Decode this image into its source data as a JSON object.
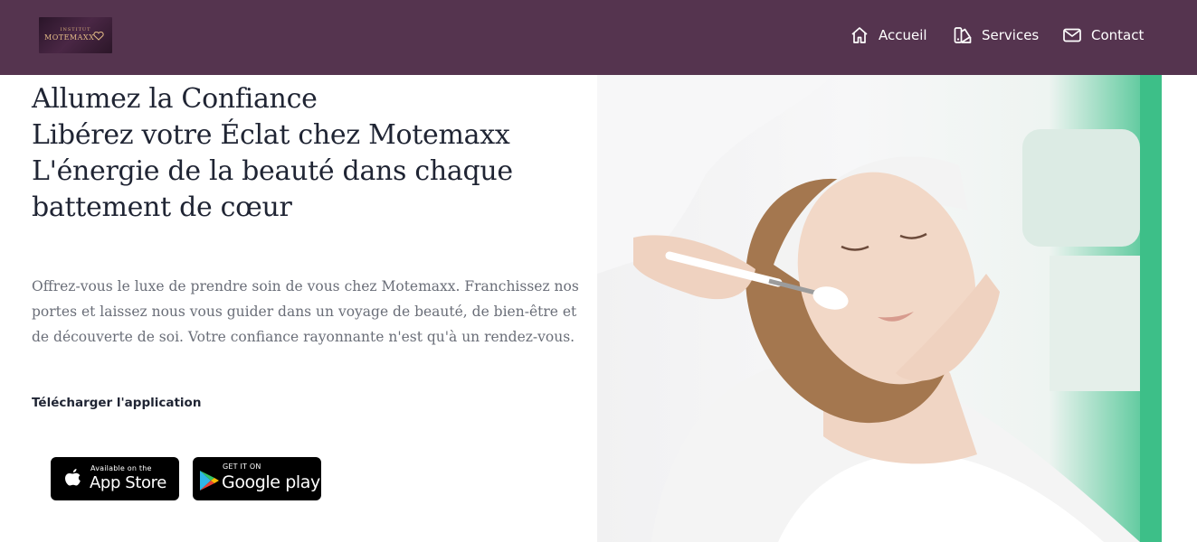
{
  "header": {
    "logo": {
      "line1": "INSTITUT",
      "line2": "MOTEMAXX"
    },
    "nav": [
      {
        "label": "Accueil",
        "icon": "home-icon"
      },
      {
        "label": "Services",
        "icon": "services-icon"
      },
      {
        "label": "Contact",
        "icon": "mail-icon"
      }
    ],
    "colors": {
      "bar": "#55344f",
      "nav_text": "#ffffff"
    }
  },
  "hero": {
    "title_lines": [
      "Allumez la Confiance",
      "Libérez votre Éclat chez Motemaxx",
      "L'énergie de la beauté dans chaque battement de cœur"
    ],
    "paragraph": "Offrez-vous le luxe de prendre soin de vous chez Motemaxx. Franchissez nos portes et laissez nous vous guider dans un voyage de beauté, de bien-être et de découverte de soi. Votre confiance rayonnante n'est qu'à un rendez-vous.",
    "download_label": "Télécharger l'application",
    "app_store": {
      "small": "Available on the",
      "big": "App Store",
      "icon": "apple-icon"
    },
    "google_play": {
      "small": "GET IT ON",
      "big": "Google play",
      "icon": "google-play-icon"
    },
    "image_icon": "facial-treatment-photo"
  }
}
